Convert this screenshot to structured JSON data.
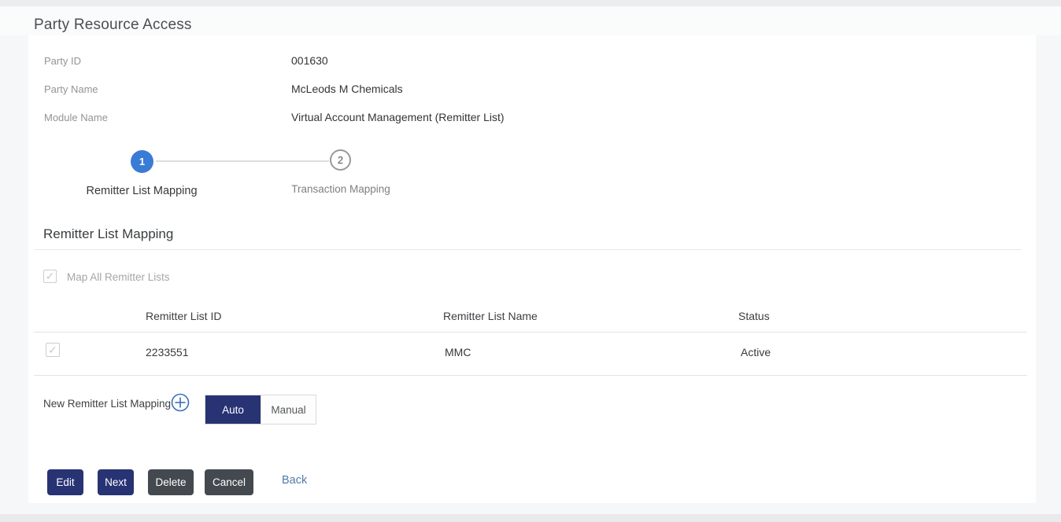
{
  "page": {
    "title": "Party Resource Access"
  },
  "party_info": {
    "fields": [
      {
        "label": "Party ID",
        "value": "001630"
      },
      {
        "label": "Party Name",
        "value": "McLeods M Chemicals"
      },
      {
        "label": "Module Name",
        "value": "Virtual Account Management (Remitter List)"
      }
    ]
  },
  "stepper": {
    "steps": [
      {
        "number": "1",
        "label": "Remitter List Mapping",
        "active": true
      },
      {
        "number": "2",
        "label": "Transaction Mapping",
        "active": false
      }
    ]
  },
  "section": {
    "heading": "Remitter List Mapping",
    "map_all_label": "Map All Remitter Lists",
    "map_all_checked": true,
    "map_all_disabled": true
  },
  "table": {
    "columns": [
      "Remitter List ID",
      "Remitter List Name",
      "Status"
    ],
    "rows": [
      {
        "checked": true,
        "id": "2233551",
        "name": "MMC",
        "status": "Active"
      }
    ]
  },
  "new_mapping": {
    "label": "New Remitter List Mapping",
    "options": [
      {
        "label": "Auto",
        "selected": true
      },
      {
        "label": "Manual",
        "selected": false
      }
    ]
  },
  "actions": {
    "edit": "Edit",
    "next": "Next",
    "delete": "Delete",
    "cancel": "Cancel",
    "back": "Back"
  },
  "icons": {
    "check_glyph": "✓",
    "plus_icon_name": "circle-plus-icon"
  },
  "colors": {
    "primary_navy": "#283374",
    "dark_button": "#44494f",
    "stepper_active_blue": "#3a7bd5",
    "back_link_blue": "#5379ab"
  }
}
